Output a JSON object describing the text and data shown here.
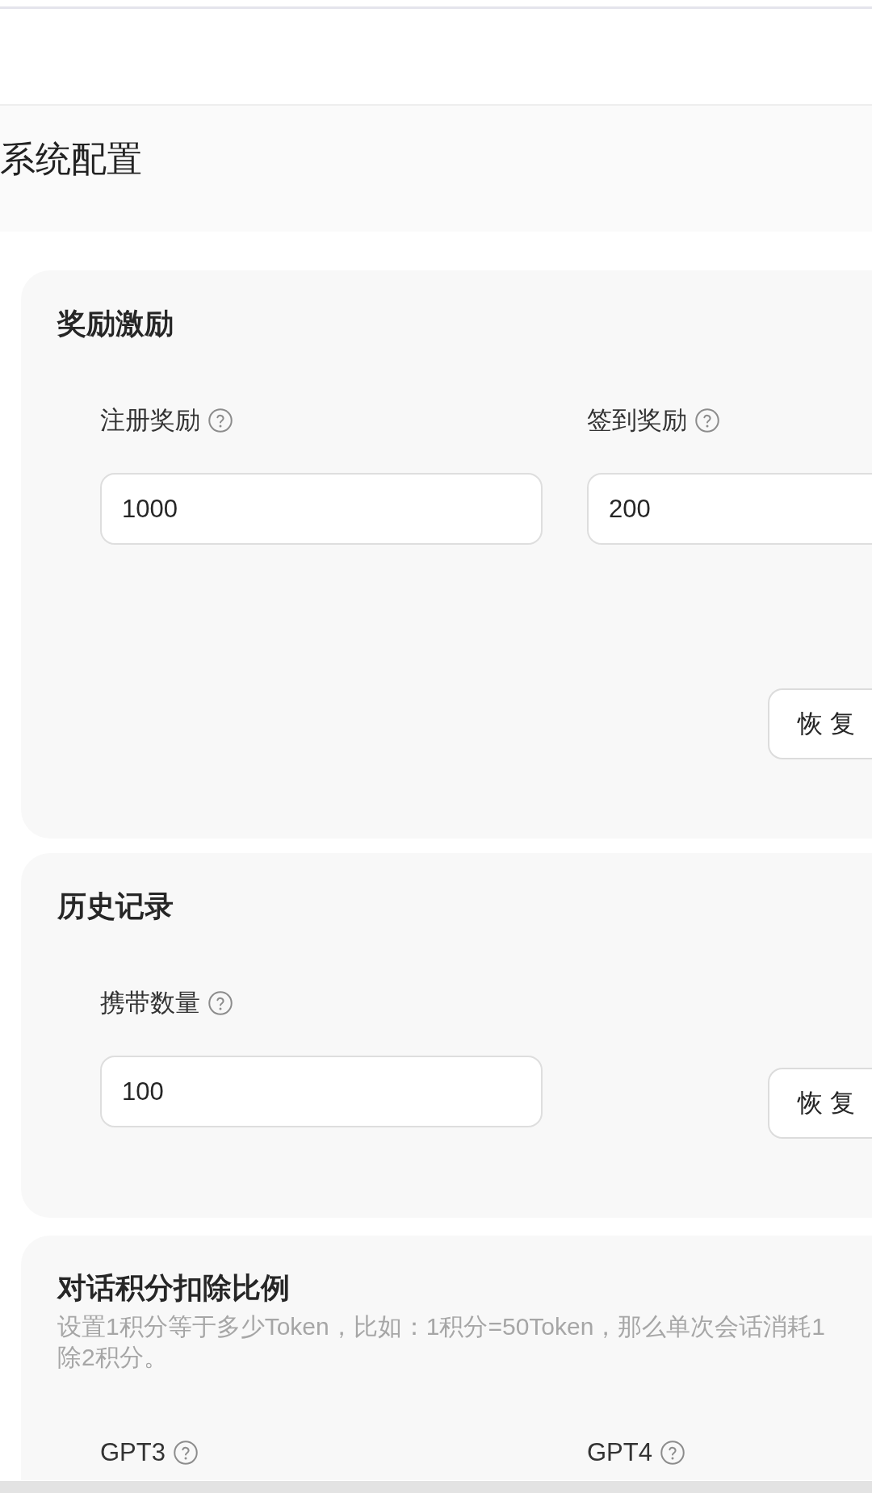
{
  "page_title": "系统配置",
  "sections": [
    {
      "title": "奖励激励",
      "fields": [
        {
          "label": "注册奖励",
          "value": "1000"
        },
        {
          "label": "签到奖励",
          "value": "200"
        }
      ],
      "button": "恢 复"
    },
    {
      "title": "历史记录",
      "fields": [
        {
          "label": "携带数量",
          "value": "100"
        }
      ],
      "button": "恢 复"
    },
    {
      "title": "对话积分扣除比例",
      "description": [
        "设置1积分等于多少Token，比如：1积分=50Token，那么单次会话消耗1",
        "除2积分。"
      ],
      "fields": [
        {
          "label": "GPT3"
        },
        {
          "label": "GPT4"
        }
      ]
    }
  ]
}
